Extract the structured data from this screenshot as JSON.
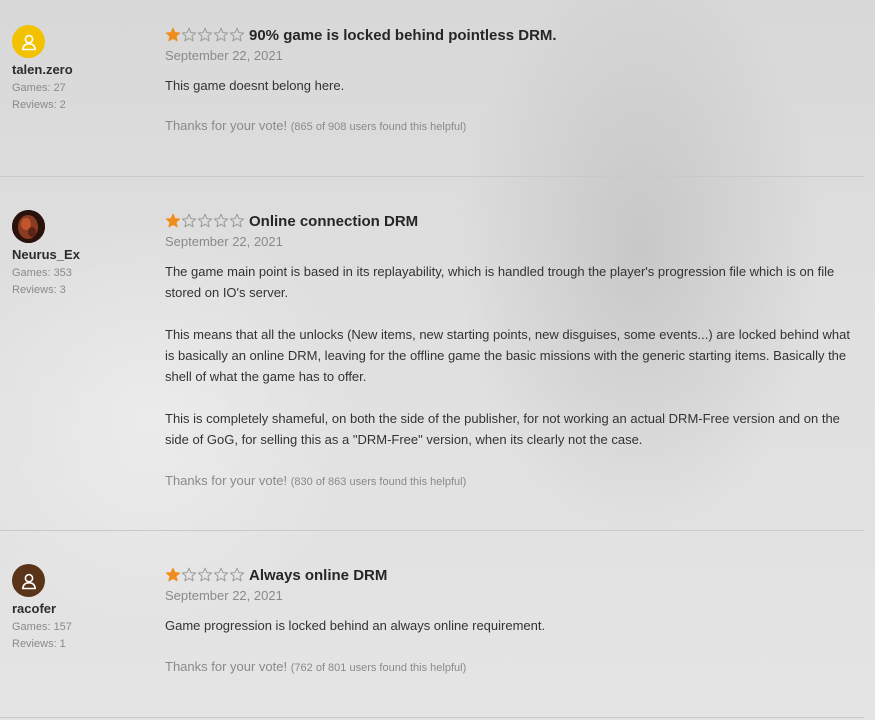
{
  "reviews": [
    {
      "user": {
        "name": "talen.zero",
        "games": "Games: 27",
        "reviews": "Reviews: 2",
        "avatar": "default-user-icon",
        "avatar_color": "#f2c100"
      },
      "rating": 1,
      "title": "90% game is locked behind pointless DRM.",
      "date": "September 22, 2021",
      "body": [
        "This game doesnt belong here."
      ],
      "thanks": "Thanks for your vote!",
      "helpful": "(865 of 908 users found this helpful)"
    },
    {
      "user": {
        "name": "Neurus_Ex",
        "games": "Games: 353",
        "reviews": "Reviews: 3",
        "avatar": "photo-avatar",
        "avatar_color": "#5a2a1c"
      },
      "rating": 1,
      "title": "Online connection DRM",
      "date": "September 22, 2021",
      "body": [
        "The game main point is based in its replayability, which is handled trough the player's progression file which is on file stored on IO's server.",
        "This means that all the unlocks (New items, new starting points, new disguises, some events...) are locked behind what is basically an online DRM, leaving for the offline game the basic missions with the generic starting items. Basically the shell of what the game has to offer.",
        "This is completely shameful, on both the side of the publisher, for not working an actual DRM-Free version and on the side of GoG, for selling this as a \"DRM-Free\" version, when its clearly not the case."
      ],
      "thanks": "Thanks for your vote!",
      "helpful": "(830 of 863 users found this helpful)"
    },
    {
      "user": {
        "name": "racofer",
        "games": "Games: 157",
        "reviews": "Reviews: 1",
        "avatar": "default-user-icon",
        "avatar_color": "#5a3418"
      },
      "rating": 1,
      "title": "Always online DRM",
      "date": "September 22, 2021",
      "body": [
        "Game progression is locked behind an always online requirement."
      ],
      "thanks": "Thanks for your vote!",
      "helpful": "(762 of 801 users found this helpful)"
    }
  ],
  "colors": {
    "star_filled": "#f08c1a",
    "star_empty": "#9a9a9a"
  }
}
